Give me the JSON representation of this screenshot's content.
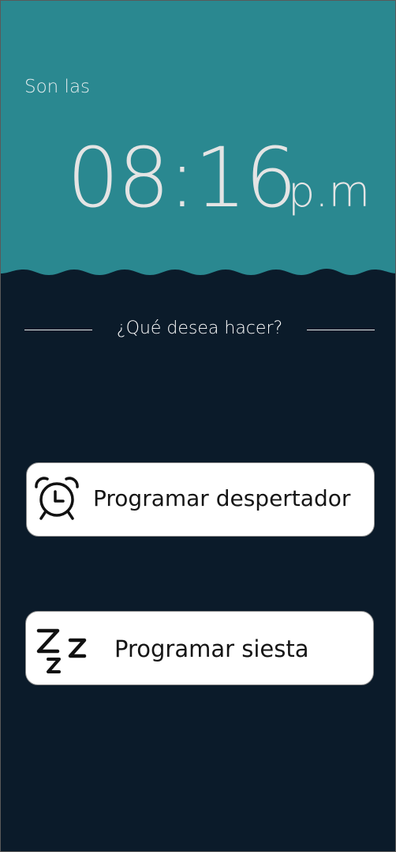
{
  "header": {
    "greeting": "Son las",
    "time": "08:16",
    "period": "p.m"
  },
  "prompt": {
    "text": "¿Qué desea hacer?"
  },
  "actions": [
    {
      "label": "Programar despertador",
      "icon": "alarm-clock-icon"
    },
    {
      "label": "Programar siesta",
      "icon": "sleep-zzz-icon"
    }
  ],
  "colors": {
    "header_bg": "#2a8890",
    "body_bg": "#0b1b2a",
    "button_bg": "#ffffff",
    "text_light": "#e4e4e4",
    "text_dark": "#151515"
  }
}
